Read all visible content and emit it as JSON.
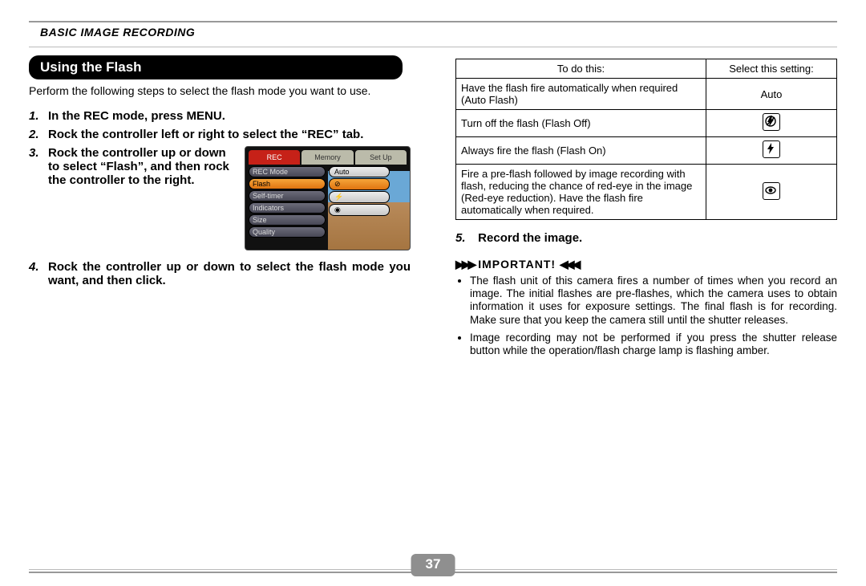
{
  "section_header": "BASIC IMAGE RECORDING",
  "title": "Using the Flash",
  "intro": "Perform the following steps to select the flash mode you want to use.",
  "steps": {
    "s1": "In the REC mode, press MENU.",
    "s2": "Rock the controller left or right to select the “REC” tab.",
    "s3": "Rock the controller up or down to select “Flash”, and then rock the controller to the right.",
    "s4": "Rock the controller up or down to select the flash mode you want, and then click.",
    "s5": "Record the image."
  },
  "lcd": {
    "tabs": [
      "REC",
      "Memory",
      "Set Up"
    ],
    "menu": [
      "REC Mode",
      "Flash",
      "Self-timer",
      "Indicators",
      "Size",
      "Quality"
    ],
    "opts": [
      "Auto",
      "⊘",
      "⚡",
      "◉"
    ]
  },
  "table": {
    "head1": "To do this:",
    "head2": "Select this setting:",
    "r1a": "Have the flash fire automatically when required (Auto Flash)",
    "r1b": "Auto",
    "r2a": "Turn off the flash (Flash Off)",
    "r3a": "Always fire the flash (Flash On)",
    "r4a": "Fire a pre-flash followed by image recording with flash, reducing the chance of red-eye in the image (Red-eye reduction). Have the flash fire automatically when required."
  },
  "important_label": "IMPORTANT!",
  "notes": {
    "n1": "The flash unit of this camera fires a number of times when you record an image. The initial flashes are pre-flashes, which the camera uses to obtain information it uses for exposure settings. The final flash is for recording. Make sure that you keep the camera still until the shutter releases.",
    "n2": "Image recording may not be performed if you press the shutter release button while the operation/flash charge lamp is flashing amber."
  },
  "page_number": "37"
}
